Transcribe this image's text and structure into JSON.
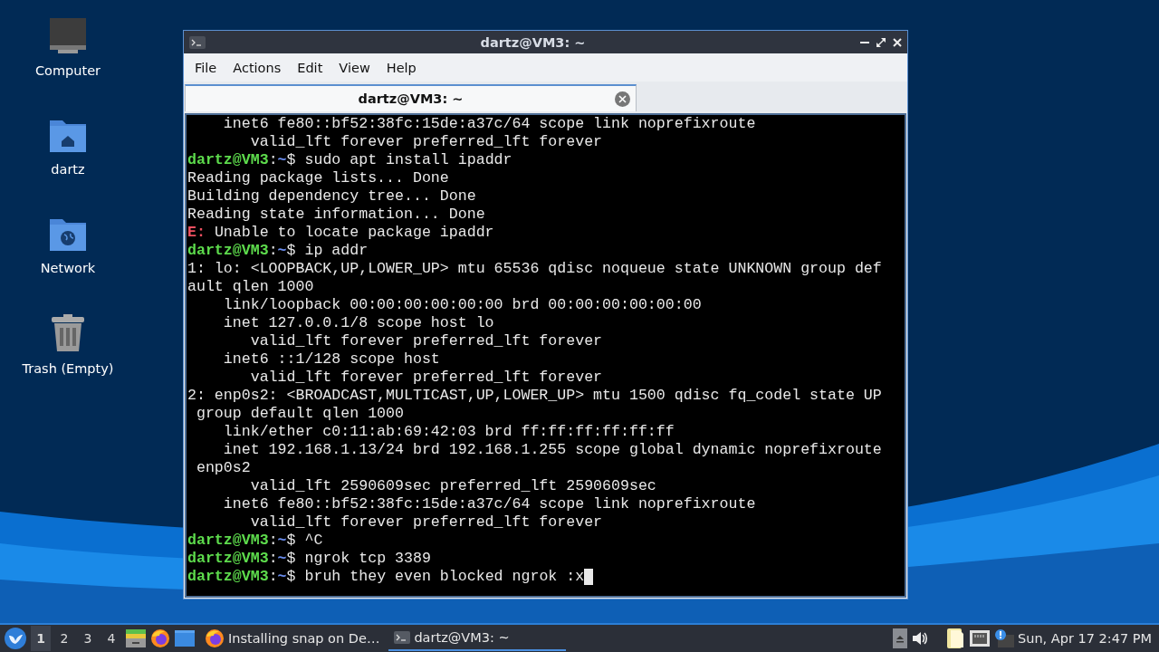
{
  "desktop_icons": [
    {
      "label": "Computer",
      "kind": "computer"
    },
    {
      "label": "dartz",
      "kind": "home"
    },
    {
      "label": "Network",
      "kind": "network"
    },
    {
      "label": "Trash (Empty)",
      "kind": "trash"
    }
  ],
  "window": {
    "title": "dartz@VM3: ~",
    "menu": [
      "File",
      "Actions",
      "Edit",
      "View",
      "Help"
    ],
    "tabs": [
      {
        "label": "dartz@VM3: ~",
        "selected": true
      }
    ],
    "terminal": {
      "lines": [
        [
          {
            "kind": "plain",
            "text": "    inet6 fe80::bf52:38fc:15de:a37c/64 scope link noprefixroute"
          }
        ],
        [
          {
            "kind": "plain",
            "text": "       valid_lft forever preferred_lft forever"
          }
        ],
        [
          {
            "kind": "user",
            "text": "dartz@VM3"
          },
          {
            "kind": "plain",
            "text": ":"
          },
          {
            "kind": "path",
            "text": "~"
          },
          {
            "kind": "plain",
            "text": "$ sudo apt install ipaddr"
          }
        ],
        [
          {
            "kind": "plain",
            "text": "Reading package lists... Done"
          }
        ],
        [
          {
            "kind": "plain",
            "text": "Building dependency tree... Done"
          }
        ],
        [
          {
            "kind": "plain",
            "text": "Reading state information... Done"
          }
        ],
        [
          {
            "kind": "error",
            "text": "E:"
          },
          {
            "kind": "plain",
            "text": " Unable to locate package ipaddr"
          }
        ],
        [
          {
            "kind": "user",
            "text": "dartz@VM3"
          },
          {
            "kind": "plain",
            "text": ":"
          },
          {
            "kind": "path",
            "text": "~"
          },
          {
            "kind": "plain",
            "text": "$ ip addr"
          }
        ],
        [
          {
            "kind": "plain",
            "text": "1: lo: <LOOPBACK,UP,LOWER_UP> mtu 65536 qdisc noqueue state UNKNOWN group def"
          }
        ],
        [
          {
            "kind": "plain",
            "text": "ault qlen 1000"
          }
        ],
        [
          {
            "kind": "plain",
            "text": "    link/loopback 00:00:00:00:00:00 brd 00:00:00:00:00:00"
          }
        ],
        [
          {
            "kind": "plain",
            "text": "    inet 127.0.0.1/8 scope host lo"
          }
        ],
        [
          {
            "kind": "plain",
            "text": "       valid_lft forever preferred_lft forever"
          }
        ],
        [
          {
            "kind": "plain",
            "text": "    inet6 ::1/128 scope host"
          }
        ],
        [
          {
            "kind": "plain",
            "text": "       valid_lft forever preferred_lft forever"
          }
        ],
        [
          {
            "kind": "plain",
            "text": "2: enp0s2: <BROADCAST,MULTICAST,UP,LOWER_UP> mtu 1500 qdisc fq_codel state UP"
          }
        ],
        [
          {
            "kind": "plain",
            "text": " group default qlen 1000"
          }
        ],
        [
          {
            "kind": "plain",
            "text": "    link/ether c0:11:ab:69:42:03 brd ff:ff:ff:ff:ff:ff"
          }
        ],
        [
          {
            "kind": "plain",
            "text": "    inet 192.168.1.13/24 brd 192.168.1.255 scope global dynamic noprefixroute"
          }
        ],
        [
          {
            "kind": "plain",
            "text": " enp0s2"
          }
        ],
        [
          {
            "kind": "plain",
            "text": "       valid_lft 2590609sec preferred_lft 2590609sec"
          }
        ],
        [
          {
            "kind": "plain",
            "text": "    inet6 fe80::bf52:38fc:15de:a37c/64 scope link noprefixroute"
          }
        ],
        [
          {
            "kind": "plain",
            "text": "       valid_lft forever preferred_lft forever"
          }
        ],
        [
          {
            "kind": "user",
            "text": "dartz@VM3"
          },
          {
            "kind": "plain",
            "text": ":"
          },
          {
            "kind": "path",
            "text": "~"
          },
          {
            "kind": "plain",
            "text": "$ ^C"
          }
        ],
        [
          {
            "kind": "user",
            "text": "dartz@VM3"
          },
          {
            "kind": "plain",
            "text": ":"
          },
          {
            "kind": "path",
            "text": "~"
          },
          {
            "kind": "plain",
            "text": "$ ngrok tcp 3389"
          }
        ],
        [
          {
            "kind": "user",
            "text": "dartz@VM3"
          },
          {
            "kind": "plain",
            "text": ":"
          },
          {
            "kind": "path",
            "text": "~"
          },
          {
            "kind": "plain",
            "text": "$ bruh they even blocked ngrok :x"
          }
        ]
      ]
    }
  },
  "taskbar": {
    "workspaces": [
      {
        "label": "1",
        "selected": true
      },
      {
        "label": "2",
        "selected": false
      },
      {
        "label": "3",
        "selected": false
      },
      {
        "label": "4",
        "selected": false
      }
    ],
    "tasks": [
      {
        "label": "Installing snap on De…",
        "kind": "firefox",
        "selected": false
      },
      {
        "label": "dartz@VM3: ~",
        "kind": "terminal",
        "selected": true
      }
    ],
    "clock": "Sun, Apr 17 2:47 PM"
  }
}
